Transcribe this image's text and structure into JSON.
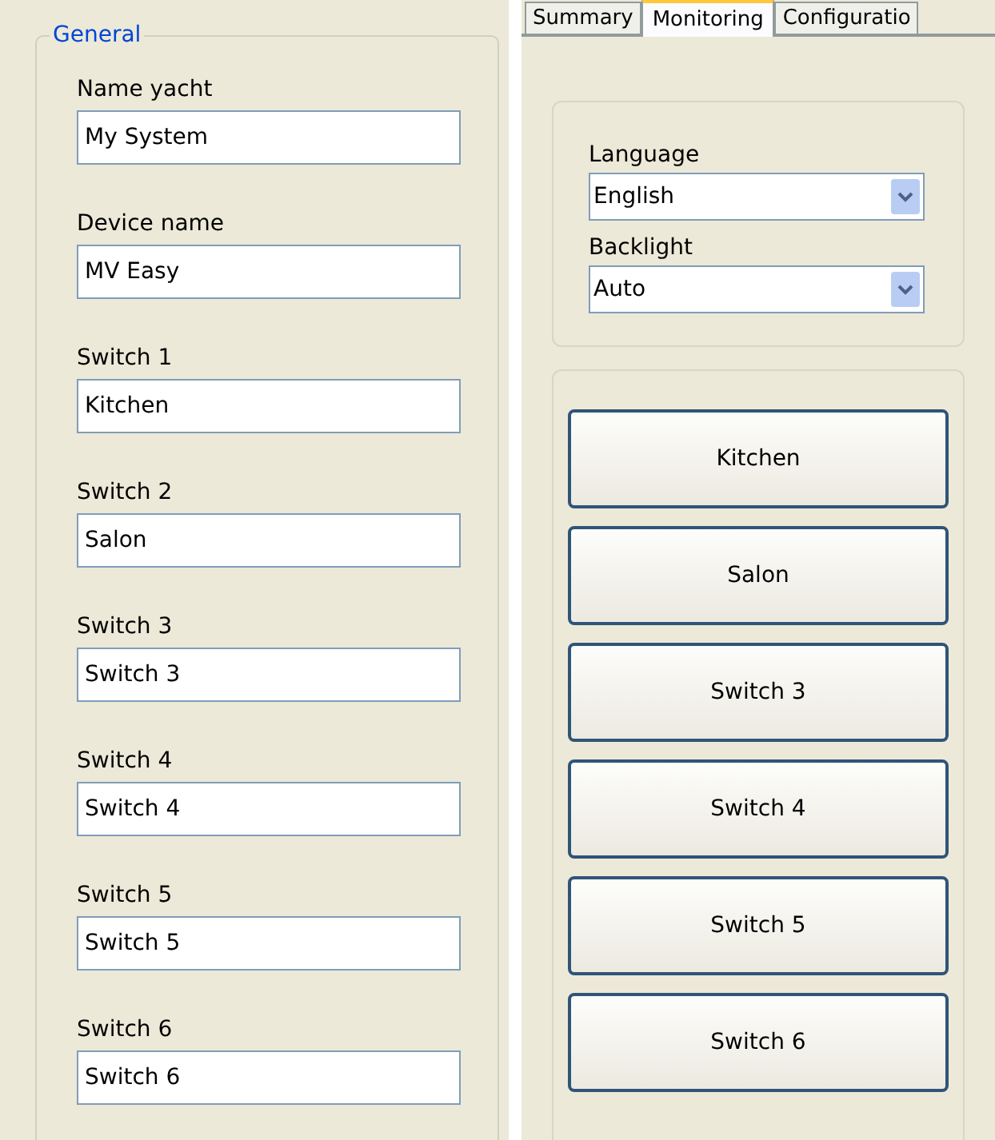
{
  "general": {
    "legend": "General",
    "fields": [
      {
        "label": "Name yacht",
        "value": "My System"
      },
      {
        "label": "Device name",
        "value": "MV Easy"
      },
      {
        "label": "Switch 1",
        "value": "Kitchen"
      },
      {
        "label": "Switch 2",
        "value": "Salon"
      },
      {
        "label": "Switch 3",
        "value": "Switch 3"
      },
      {
        "label": "Switch 4",
        "value": "Switch 4"
      },
      {
        "label": "Switch 5",
        "value": "Switch 5"
      },
      {
        "label": "Switch 6",
        "value": "Switch 6"
      }
    ]
  },
  "tabs": [
    {
      "label": "Summary",
      "selected": false
    },
    {
      "label": "Monitoring",
      "selected": true
    },
    {
      "label": "Configuratio",
      "selected": false
    }
  ],
  "settings": [
    {
      "label": "Language",
      "value": "English"
    },
    {
      "label": "Backlight",
      "value": "Auto"
    }
  ],
  "switch_buttons": [
    "Kitchen",
    "Salon",
    "Switch 3",
    "Switch 4",
    "Switch 5",
    "Switch 6"
  ]
}
